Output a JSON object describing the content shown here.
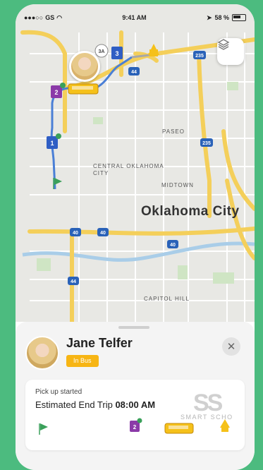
{
  "status_bar": {
    "carrier": "GS",
    "time": "9:41 AM",
    "battery": "58 %"
  },
  "map": {
    "city_labels": [
      "PASEO",
      "CENTRAL OKLAHOMA CITY",
      "MIDTOWN",
      "CAPITOL HILL"
    ],
    "city_name": "Oklahoma City",
    "highway_shields": [
      "235",
      "44",
      "235",
      "40",
      "40",
      "40",
      "44",
      "3A"
    ],
    "stop_markers": [
      "3",
      "2",
      "1"
    ]
  },
  "driver": {
    "name": "Jane Telfer",
    "status": "In Bus"
  },
  "trip": {
    "pickup_status": "Pick up started",
    "eta_label": "Estimated End Trip",
    "eta_time": "08:00 AM"
  },
  "watermark": {
    "logo": "SS",
    "text": "SMART SCHO"
  },
  "colors": {
    "background": "#4cbb7f",
    "route": "#4a7fd6",
    "badge": "#f7b514",
    "bus": "#f5c11a",
    "stop_marker_blue": "#2f5ec4",
    "stop_marker_purple": "#8b3aa8"
  }
}
